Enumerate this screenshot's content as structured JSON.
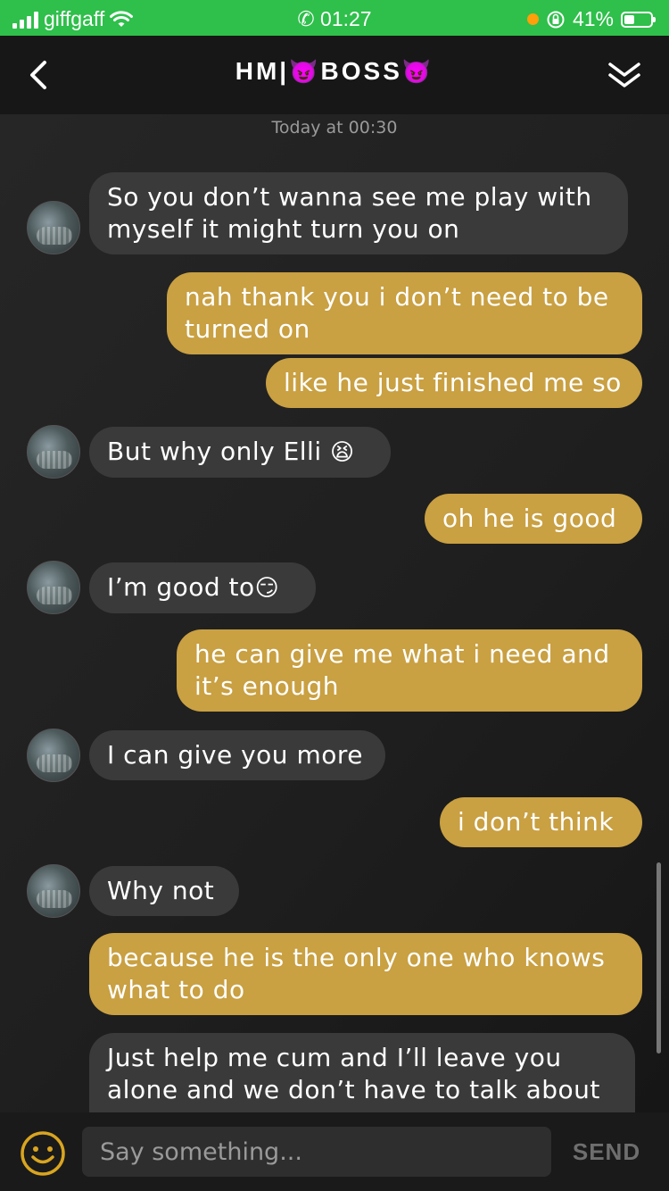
{
  "status_bar": {
    "carrier": "giffgaff",
    "time": "01:27",
    "battery": "41%",
    "battery_level": 0.41,
    "icons": [
      "signal-icon",
      "wifi-icon",
      "phone-icon",
      "orientation-lock-icon",
      "battery-icon"
    ]
  },
  "header": {
    "title_prefix": "HM|",
    "title_middle": "BOSS",
    "emoji": "😈",
    "back_icon": "chevron-left-icon",
    "collapse_icon": "double-chevron-down-icon"
  },
  "chat": {
    "timestamp": "Today at 00:30",
    "messages": [
      {
        "dir": "in",
        "lines": [
          "So you don’t wanna see me play with",
          "myself it might turn you on"
        ]
      },
      {
        "dir": "out",
        "lines": [
          "nah thank you i don’t need to be",
          "turned on"
        ]
      },
      {
        "dir": "out",
        "lines": [
          "like he just finished me so"
        ]
      },
      {
        "dir": "in",
        "lines": [
          "But why only Elli"
        ],
        "emoji": "😫"
      },
      {
        "dir": "out",
        "lines": [
          "oh he is good"
        ]
      },
      {
        "dir": "in",
        "lines": [
          "I’m good to"
        ],
        "emoji": "😏"
      },
      {
        "dir": "out",
        "lines": [
          "he can give me what i need and",
          "it’s enough"
        ]
      },
      {
        "dir": "in",
        "lines": [
          "I can give you more"
        ]
      },
      {
        "dir": "out",
        "lines": [
          "i don’t think"
        ]
      },
      {
        "dir": "in",
        "lines": [
          "Why not"
        ]
      },
      {
        "dir": "out",
        "lines": [
          "because he is the only one who knows",
          "what to do"
        ]
      },
      {
        "dir": "in",
        "lines": [
          "Just help me cum and I’ll leave you",
          "alone and we don’t have to talk about"
        ]
      }
    ]
  },
  "input_bar": {
    "placeholder": "Say something...",
    "send_label": "SEND",
    "emoji_icon": "smiley-icon"
  },
  "colors": {
    "status_green": "#2fbf4b",
    "outgoing_bubble": "#c9a042",
    "incoming_bubble": "#3a3a3a",
    "background": "#1b1b1b"
  }
}
